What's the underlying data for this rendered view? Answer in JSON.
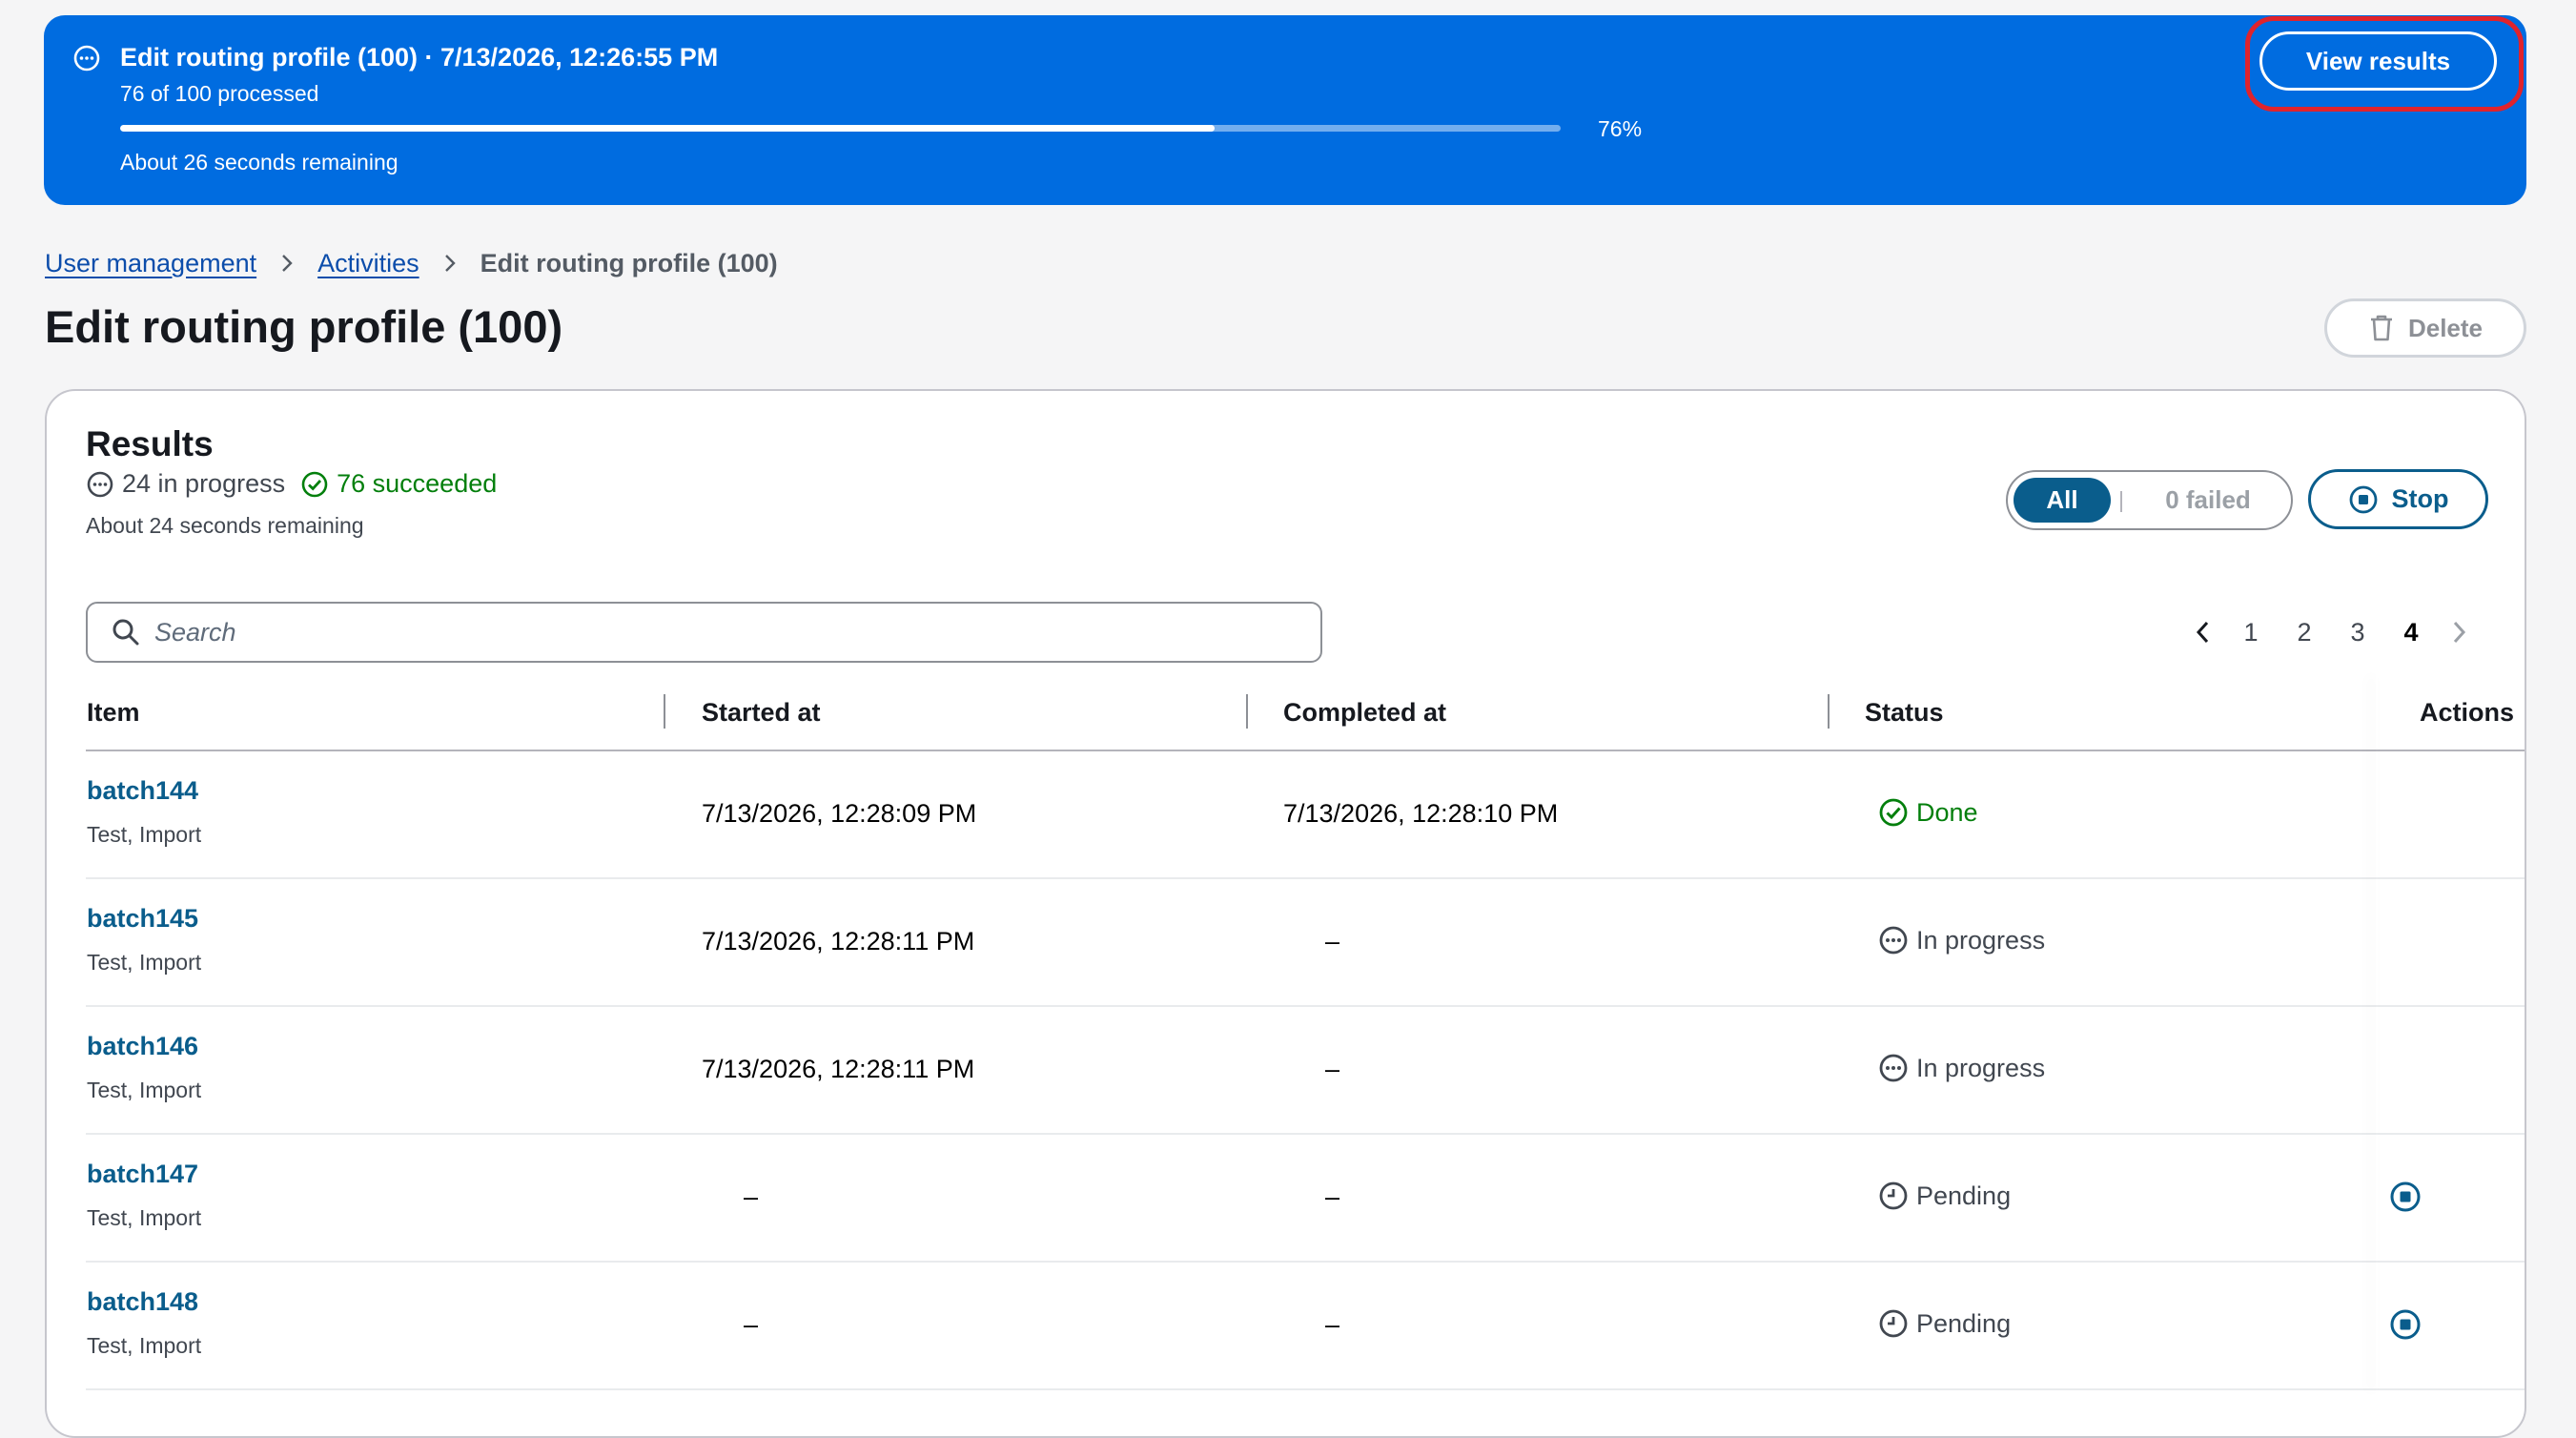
{
  "banner": {
    "title": "Edit routing profile (100) · 7/13/2026, 12:26:55 PM",
    "processed": "76 of 100 processed",
    "progress_percent": 76,
    "progress_label": "76%",
    "remaining": "About 26 seconds remaining",
    "view_results_label": "View results",
    "color": "#006ce0"
  },
  "breadcrumb": {
    "items": [
      "User management",
      "Activities"
    ],
    "current": "Edit routing profile (100)"
  },
  "page": {
    "title": "Edit routing profile (100)",
    "delete_label": "Delete"
  },
  "results": {
    "title": "Results",
    "in_progress": "24 in progress",
    "succeeded": "76 succeeded",
    "remaining": "About 24 seconds remaining",
    "filter": {
      "all_label": "All",
      "failed_label": "0 failed",
      "selected": "All"
    },
    "stop_label": "Stop",
    "search_placeholder": "Search",
    "pagination": {
      "pages": [
        "1",
        "2",
        "3",
        "4"
      ],
      "current": "4"
    },
    "columns": [
      "Item",
      "Started at",
      "Completed at",
      "Status",
      "Actions"
    ],
    "rows": [
      {
        "item": "batch144",
        "desc": "Test, Import",
        "started": "7/13/2026, 12:28:09 PM",
        "completed": "7/13/2026, 12:28:10 PM",
        "status": "Done"
      },
      {
        "item": "batch145",
        "desc": "Test, Import",
        "started": "7/13/2026, 12:28:11 PM",
        "completed": "–",
        "status": "In progress"
      },
      {
        "item": "batch146",
        "desc": "Test, Import",
        "started": "7/13/2026, 12:28:11 PM",
        "completed": "–",
        "status": "In progress"
      },
      {
        "item": "batch147",
        "desc": "Test, Import",
        "started": "–",
        "completed": "–",
        "status": "Pending"
      },
      {
        "item": "batch148",
        "desc": "Test, Import",
        "started": "–",
        "completed": "–",
        "status": "Pending"
      }
    ]
  },
  "icons": {
    "banner_status": "in-progress-icon",
    "breadcrumb_separator": "chevron-right-icon",
    "delete": "trash-icon",
    "stop": "stop-circle-icon",
    "search": "search-icon",
    "pager_prev": "chevron-left-icon",
    "pager_next": "chevron-right-icon",
    "done": "check-circle-icon",
    "in_progress": "in-progress-icon",
    "pending": "clock-icon",
    "row_action": "stop-circle-icon"
  },
  "colors": {
    "link": "#0c4dab",
    "primary": "#0a5d8c",
    "success": "#037f0c",
    "highlight_ring": "#e0232c"
  }
}
